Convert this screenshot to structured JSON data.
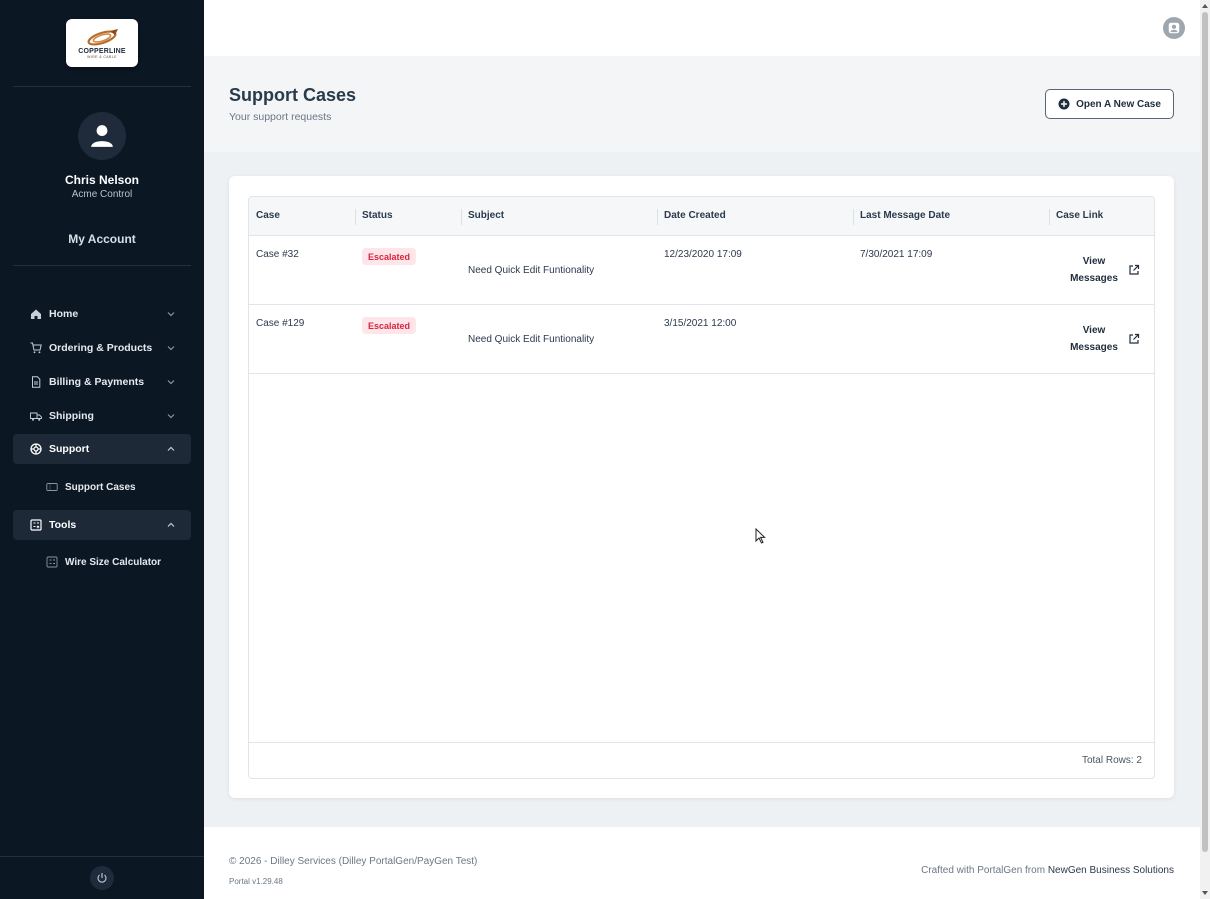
{
  "sidebar": {
    "logo": {
      "text": "COPPERLINE",
      "subtext": "WIRE & CABLE"
    },
    "user": {
      "name": "Chris Nelson",
      "company": "Acme Control"
    },
    "my_account": "My Account",
    "nav": [
      {
        "label": "Home",
        "icon": "home-icon"
      },
      {
        "label": "Ordering & Products",
        "icon": "cart-icon"
      },
      {
        "label": "Billing & Payments",
        "icon": "document-icon"
      },
      {
        "label": "Shipping",
        "icon": "truck-icon"
      },
      {
        "label": "Support",
        "icon": "lifebuoy-icon",
        "expanded": true
      },
      {
        "label": "Tools",
        "icon": "calculator-icon",
        "expanded": true
      }
    ],
    "sub_items": {
      "support_cases": "Support Cases",
      "wire_size_calculator": "Wire Size Calculator"
    }
  },
  "header": {
    "title": "Support Cases",
    "subtitle": "Your support requests",
    "new_case_label": "Open A New Case"
  },
  "table": {
    "columns": [
      "Case",
      "Status",
      "Subject",
      "Date Created",
      "Last Message Date",
      "Case Link"
    ],
    "rows": [
      {
        "case": "Case #32",
        "status": "Escalated",
        "subject": "Need Quick Edit Funtionality",
        "date_created": "12/23/2020 17:09",
        "last_message": "7/30/2021 17:09",
        "link_line1": "View",
        "link_line2": "Messages"
      },
      {
        "case": "Case #129",
        "status": "Escalated",
        "subject": "Need Quick Edit Funtionality",
        "date_created": "3/15/2021 12:00",
        "last_message": "",
        "link_line1": "View",
        "link_line2": "Messages"
      }
    ],
    "total_rows": "Total Rows: 2"
  },
  "footer": {
    "copyright": "© 2026 - Dilley Services (Dilley PortalGen/PayGen Test)",
    "version": "Portal v1.29.48",
    "crafted_prefix": "Crafted with PortalGen from ",
    "crafted_link": "NewGen Business Solutions"
  },
  "colors": {
    "sidebar_bg": "#0c1724",
    "badge_bg": "#fde5ea",
    "badge_text": "#d7263d"
  }
}
